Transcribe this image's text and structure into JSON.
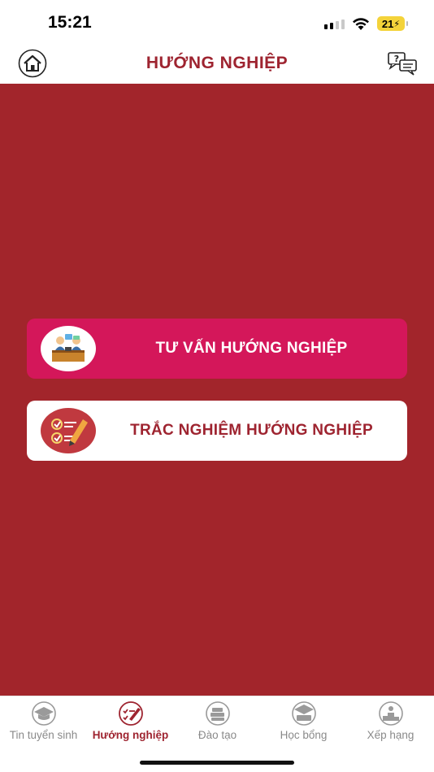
{
  "status_bar": {
    "time": "15:21",
    "battery": "21",
    "icons": [
      "signal-icon",
      "wifi-icon",
      "battery-charging-icon"
    ]
  },
  "header": {
    "title": "HƯỚNG NGHIỆP",
    "left_icon": "home-icon",
    "right_icon": "chat-question-icon"
  },
  "main": {
    "background": "#a2252b",
    "cards": [
      {
        "label": "TƯ VẤN HƯỚNG NGHIỆP",
        "icon": "counseling-icon",
        "color": "#d4175a"
      },
      {
        "label": "TRẮC NGHIỆM HƯỚNG NGHIỆP",
        "icon": "quiz-checklist-icon",
        "color": "#ffffff"
      }
    ]
  },
  "tabbar": {
    "active_index": 1,
    "accent": "#9e2430",
    "tabs": [
      {
        "label": "Tin tuyển sinh",
        "icon": "graduation-cap-icon"
      },
      {
        "label": "Hướng nghiệp",
        "icon": "career-quiz-icon"
      },
      {
        "label": "Đào tạo",
        "icon": "books-icon"
      },
      {
        "label": "Học bổng",
        "icon": "scholarship-icon"
      },
      {
        "label": "Xếp hạng",
        "icon": "ranking-podium-icon"
      }
    ]
  }
}
